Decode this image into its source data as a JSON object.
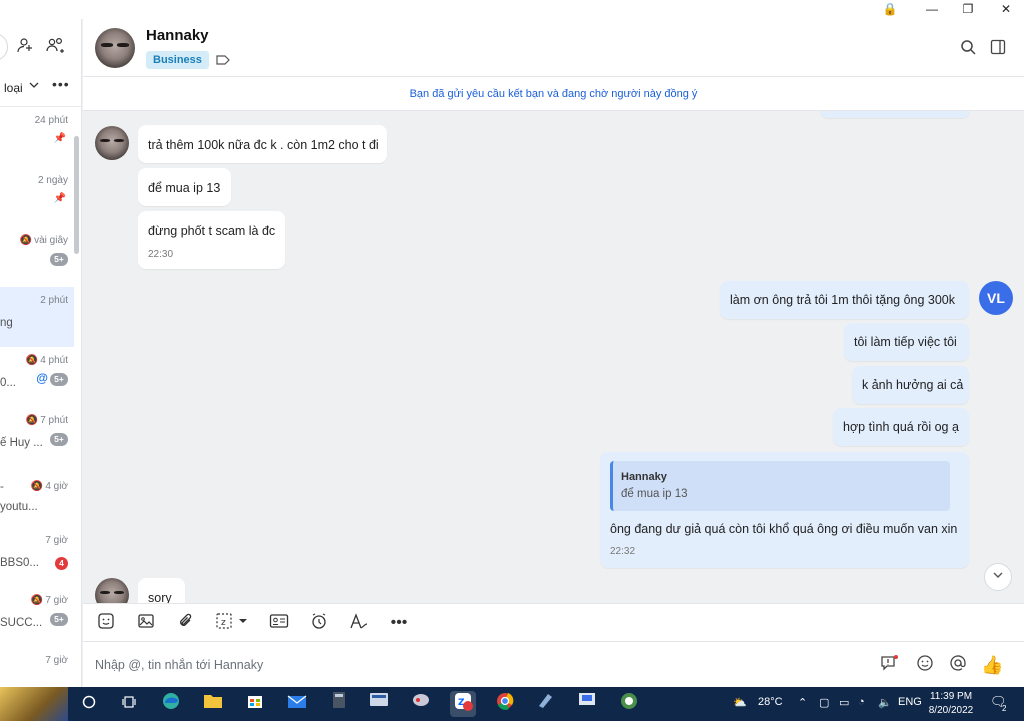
{
  "window": {
    "lock_glyph": "🔒",
    "minimize_glyph": "—",
    "restore_glyph": "❐",
    "close_glyph": "✕"
  },
  "sidebar": {
    "filter_label": "loại",
    "conversations": [
      {
        "time": "24 phút",
        "preview": "",
        "pinned": true
      },
      {
        "time": "2 ngày",
        "preview": "",
        "pinned": true
      },
      {
        "time": "vài giây",
        "preview": "",
        "muted": true,
        "badge": "5+"
      },
      {
        "time": "2 phút",
        "preview": "ng",
        "active": true
      },
      {
        "time": "4 phút",
        "preview": "0...",
        "muted": true,
        "mention": "@",
        "badge": "5+"
      },
      {
        "time": "7 phút",
        "preview": "ế Huy ...",
        "muted": true,
        "badge": "5+"
      },
      {
        "time": "4 giờ",
        "preview": "youtu...",
        "muted": true,
        "top_text": "-"
      },
      {
        "time": "7 giờ",
        "preview": "BBS0...",
        "badge": "4",
        "badge_red": true
      },
      {
        "time": "7 giờ",
        "preview": "SUCC...",
        "muted": true,
        "badge": "5+"
      },
      {
        "time": "7 giờ",
        "preview": ""
      }
    ]
  },
  "header": {
    "contact_name": "Hannaky",
    "tag": "Business"
  },
  "banner": {
    "text": "Bạn đã gửi yêu cầu kết bạn và đang chờ người này đồng ý"
  },
  "messages": {
    "incoming": [
      {
        "text": "trả thêm 100k nữa đc k . còn 1m2 cho t đi"
      },
      {
        "text": "để mua ip 13"
      },
      {
        "text": "đừng phốt t scam là đc",
        "time": "22:30"
      },
      {
        "text": "sory"
      }
    ],
    "outgoing": [
      {
        "text": "làm ơn ông trả tôi 1m thôi tặng ông 300k"
      },
      {
        "text": "tôi làm tiếp việc tôi"
      },
      {
        "text": "k ảnh hưởng ai cả"
      },
      {
        "text": "hợp tình quá rồi og ạ"
      },
      {
        "quote_name": "Hannaky",
        "quote_text": "để mua ip 13",
        "text": "ông đang dư giả quá còn tôi khổ quá ông ơi điều muốn van xin",
        "time": "22:32"
      }
    ],
    "self_avatar_initials": "VL"
  },
  "composer": {
    "placeholder": "Nhập @, tin nhắn tới Hannaky"
  },
  "taskbar": {
    "weather": "28°C",
    "language": "ENG",
    "time": "11:39 PM",
    "date": "8/20/2022",
    "notification_count": "2",
    "zalo_badge": "5+"
  },
  "colors": {
    "accent": "#1a5fd9",
    "outgoing_bubble": "#e3eefd",
    "incoming_bubble": "#ffffff",
    "chat_background": "#eef0f1",
    "self_avatar": "#3a6ee8",
    "taskbar": "#0f2748"
  }
}
